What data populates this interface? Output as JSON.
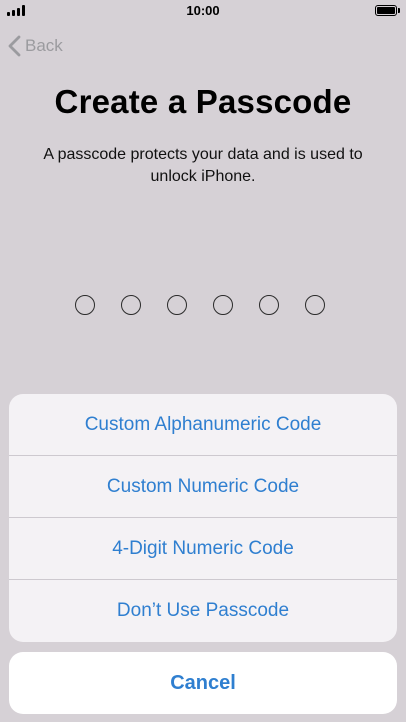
{
  "status_bar": {
    "time": "10:00"
  },
  "nav": {
    "back_label": "Back"
  },
  "header": {
    "title": "Create a Passcode",
    "description": "A passcode protects your data and is used to unlock iPhone."
  },
  "passcode": {
    "digits_shown": 6,
    "digits_entered": 0
  },
  "options_sheet": {
    "options": [
      {
        "label": "Custom Alphanumeric Code"
      },
      {
        "label": "Custom Numeric Code"
      },
      {
        "label": "4-Digit Numeric Code"
      },
      {
        "label": "Don’t Use Passcode"
      }
    ],
    "cancel_label": "Cancel"
  },
  "colors": {
    "background": "#d6d1d6",
    "accent": "#2f7fd0",
    "back_disabled": "#9b9b9f"
  },
  "icons": {
    "back": "chevron-left-icon",
    "signal": "signal-bars-icon",
    "battery": "battery-icon"
  }
}
